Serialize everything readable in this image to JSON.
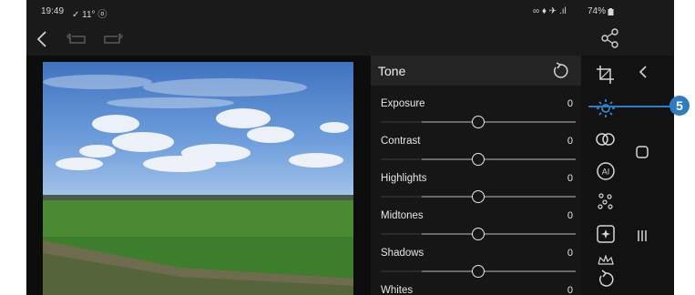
{
  "status_bar": {
    "time": "19:49",
    "left_icons": "✓ 11° ⓞ",
    "right_icons": "∞ ♦ ✈ .ıl",
    "battery": "74%"
  },
  "top_bar": {
    "back_icon": "chevron-left",
    "undo_icon": "undo-arrow",
    "redo_icon": "redo-arrow",
    "share_icon": "share"
  },
  "tone_panel": {
    "title": "Tone",
    "sliders": [
      {
        "label": "Exposure",
        "value": "0",
        "position": 0.5
      },
      {
        "label": "Contrast",
        "value": "0",
        "position": 0.5
      },
      {
        "label": "Highlights",
        "value": "0",
        "position": 0.5
      },
      {
        "label": "Midtones",
        "value": "0",
        "position": 0.5
      },
      {
        "label": "Shadows",
        "value": "0",
        "position": 0.5
      },
      {
        "label": "Whites",
        "value": "0",
        "position": 0.5
      }
    ]
  },
  "tool_rail": {
    "tools": [
      "crop-icon",
      "tone-sun-icon",
      "color-circles-icon",
      "ai-icon",
      "effects-dots-icon",
      "sparkle-frame-icon",
      "presets-icon",
      "reset-icon"
    ],
    "active_tool": "tone-sun-icon",
    "accent_color": "#2f7cc4"
  },
  "callout": {
    "number": "5"
  }
}
